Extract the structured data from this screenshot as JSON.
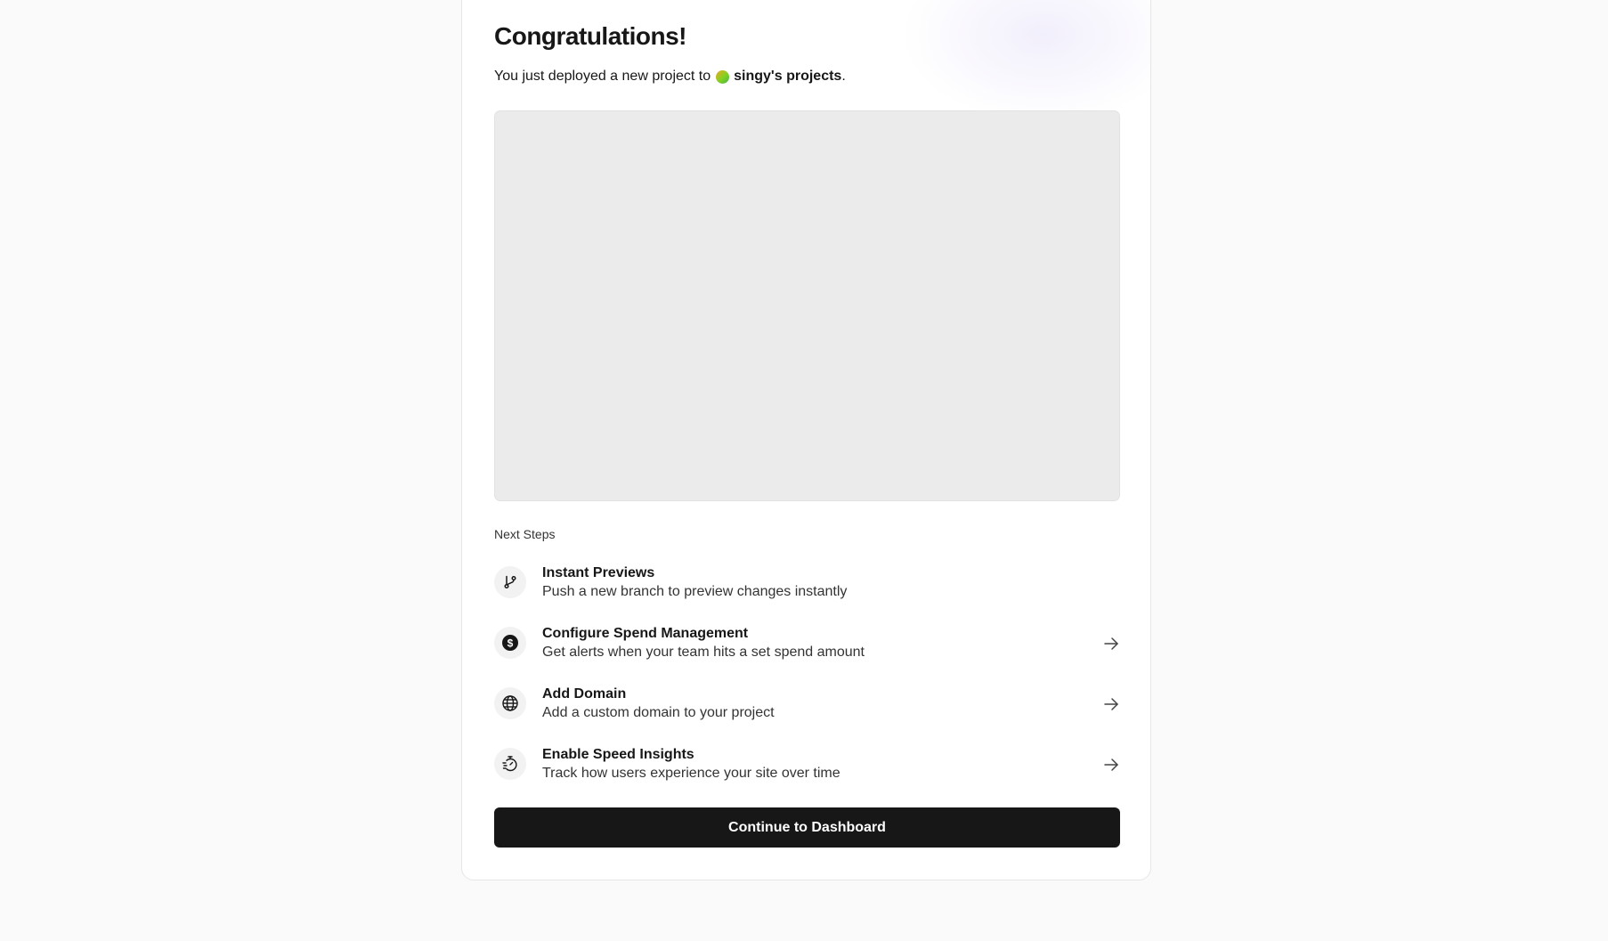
{
  "header": {
    "title": "Congratulations!",
    "subtitle_prefix": "You just deployed a new project to",
    "team_name": "singy's projects",
    "subtitle_suffix": "."
  },
  "preview": {
    "state": "loading"
  },
  "next_steps": {
    "label": "Next Steps",
    "items": [
      {
        "title": "Instant Previews",
        "description": "Push a new branch to preview changes instantly",
        "icon": "git-branch-icon",
        "has_arrow": false
      },
      {
        "title": "Configure Spend Management",
        "description": "Get alerts when your team hits a set spend amount",
        "icon": "dollar-icon",
        "has_arrow": true
      },
      {
        "title": "Add Domain",
        "description": "Add a custom domain to your project",
        "icon": "globe-icon",
        "has_arrow": true
      },
      {
        "title": "Enable Speed Insights",
        "description": "Track how users experience your site over time",
        "icon": "stopwatch-icon",
        "has_arrow": true
      }
    ]
  },
  "cta": {
    "label": "Continue to Dashboard"
  },
  "colors": {
    "background": "#fafafa",
    "card": "#ffffff",
    "primary_button": "#171717",
    "preview_placeholder": "#ebebeb"
  }
}
